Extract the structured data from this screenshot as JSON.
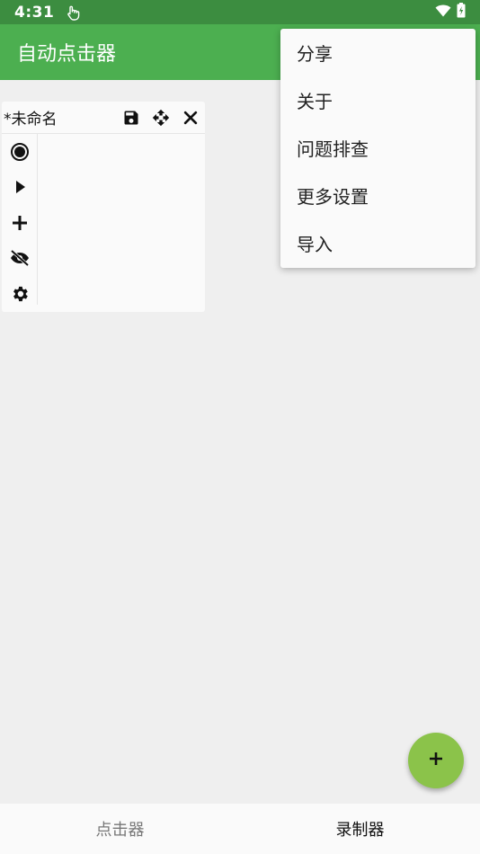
{
  "status_bar": {
    "time": "4:31",
    "icons": [
      "touch-icon",
      "wifi-icon",
      "battery-charging-icon"
    ]
  },
  "app_bar": {
    "title": "自动点击器",
    "color": "#4caf50"
  },
  "panel": {
    "title": "*未命名",
    "header_icons": [
      "save-icon",
      "move-icon",
      "close-icon"
    ],
    "tool_icons": [
      "record-icon",
      "play-icon",
      "add-icon",
      "hide-icon",
      "settings-icon"
    ]
  },
  "menu": {
    "items": [
      {
        "label": "分享"
      },
      {
        "label": "关于"
      },
      {
        "label": "问题排查"
      },
      {
        "label": "更多设置"
      },
      {
        "label": "导入"
      }
    ]
  },
  "fab": {
    "icon": "add-icon",
    "color": "#8bc34a"
  },
  "bottom_nav": {
    "tabs": [
      {
        "label": "点击器",
        "active": false
      },
      {
        "label": "录制器",
        "active": true
      }
    ]
  }
}
